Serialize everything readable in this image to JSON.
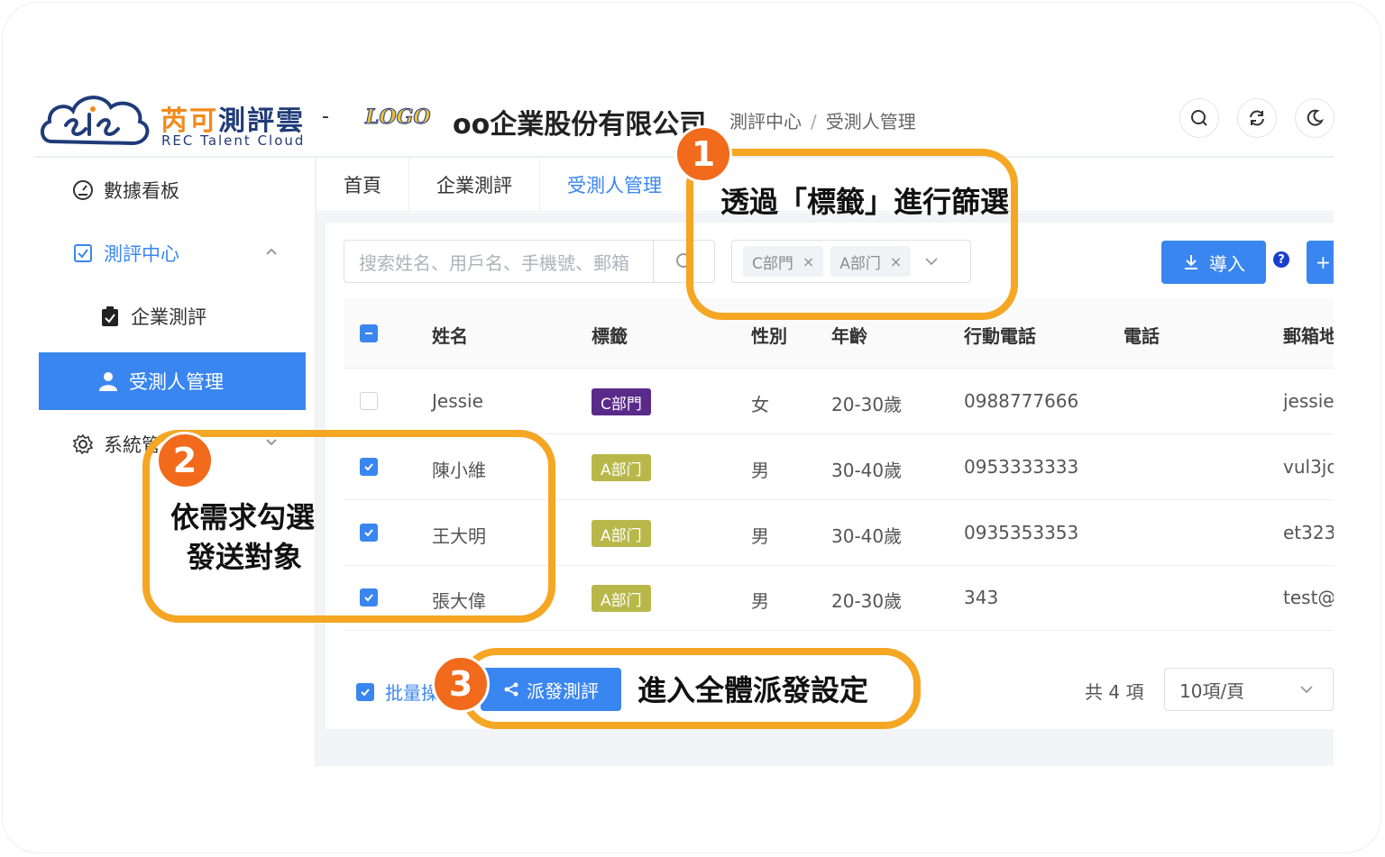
{
  "header": {
    "brand_cn_a": "芮",
    "brand_cn_b": "可",
    "brand_cn_c": "測評雲",
    "brand_en": "REC Talent Cloud",
    "dash": "-",
    "logo_text": "LOGO",
    "company": "oo企業股份有限公司",
    "breadcrumb": [
      "測評中心",
      "/",
      "受測人管理"
    ]
  },
  "sidebar": {
    "items": [
      {
        "label": "數據看板",
        "icon": "dashboard-icon"
      },
      {
        "label": "測評中心",
        "icon": "checkbox-square-icon"
      },
      {
        "label": "企業測評",
        "icon": "clipboard-check-icon"
      },
      {
        "label": "受測人管理",
        "icon": "user-icon"
      },
      {
        "label": "系統管",
        "icon": "gear-icon"
      }
    ]
  },
  "tabs": [
    "首頁",
    "企業測評",
    "受測人管理"
  ],
  "toolbar": {
    "search_placeholder": "搜索姓名、用戶名、手機號、郵箱",
    "chips": [
      "C部門",
      "A部门"
    ],
    "chip_close": "×",
    "import_label": "導入",
    "help": "?",
    "more_label": "+"
  },
  "table": {
    "headers": [
      "姓名",
      "標籤",
      "性別",
      "年齡",
      "行動電話",
      "電話",
      "郵箱地"
    ],
    "rows": [
      {
        "checked": false,
        "name": "Jessie",
        "tag": "C部門",
        "tag_kind": "c",
        "gender": "女",
        "age": "20-30歲",
        "mobile": "0988777666",
        "phone": "",
        "email": "jessie"
      },
      {
        "checked": true,
        "name": "陳小維",
        "tag": "A部门",
        "tag_kind": "a",
        "gender": "男",
        "age": "30-40歲",
        "mobile": "0953333333",
        "phone": "",
        "email": "vul3jo"
      },
      {
        "checked": true,
        "name": "王大明",
        "tag": "A部门",
        "tag_kind": "a",
        "gender": "男",
        "age": "30-40歲",
        "mobile": "0935353353",
        "phone": "",
        "email": "et323"
      },
      {
        "checked": true,
        "name": "張大偉",
        "tag": "A部门",
        "tag_kind": "a",
        "gender": "男",
        "age": "20-30歲",
        "mobile": "343",
        "phone": "",
        "email": "test@"
      }
    ]
  },
  "footer": {
    "batch_label": "批量操",
    "dispatch_label": "派發測評",
    "total": "共 4 項",
    "page_size": "10項/頁"
  },
  "annotations": [
    {
      "num": "1",
      "text": "透過「標籤」進行篩選"
    },
    {
      "num": "2",
      "text_line1": "依需求勾選",
      "text_line2": "發送對象"
    },
    {
      "num": "3",
      "text": "進入全體派發設定"
    }
  ],
  "colors": {
    "primary": "#3a86f0",
    "annotation_orange": "#f5a623",
    "annotation_badge": "#f26a1b",
    "tag_c": "#5a2a8a",
    "tag_a": "#b8b84a"
  }
}
